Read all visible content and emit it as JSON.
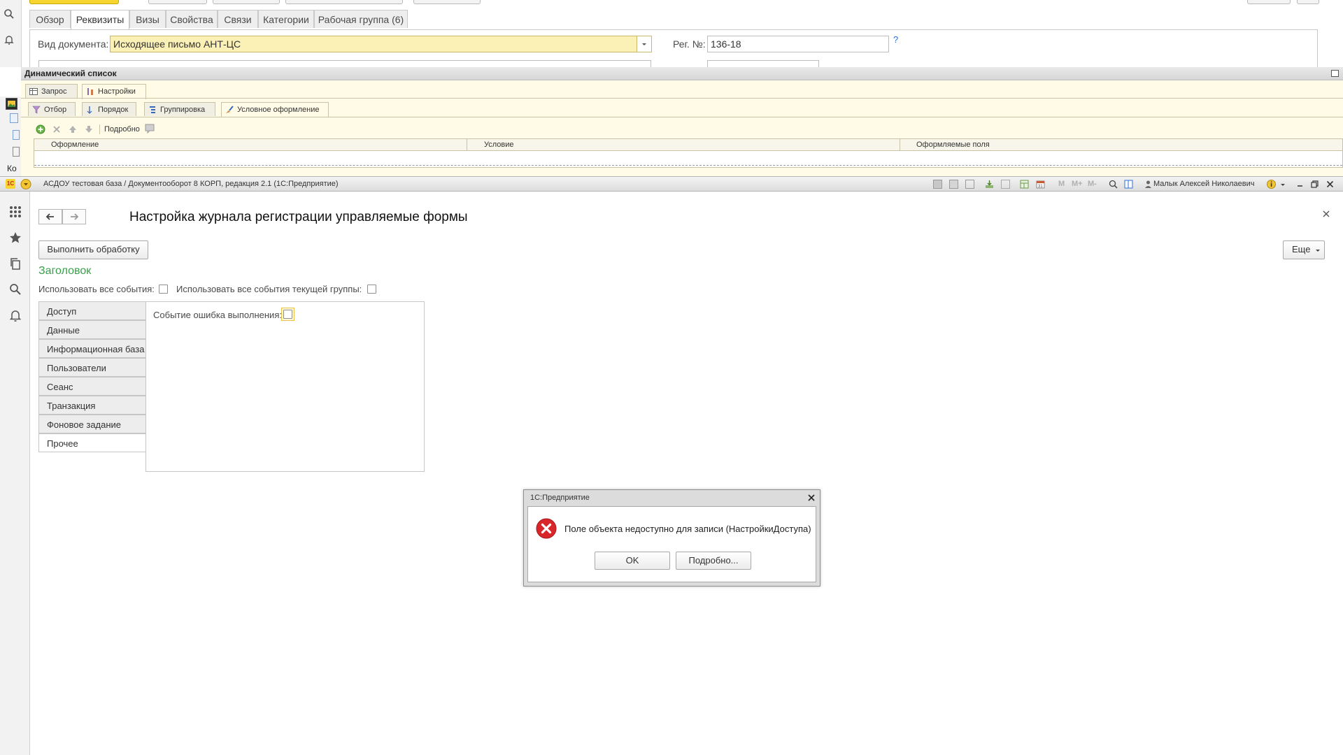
{
  "background_form": {
    "tabs": [
      "Обзор",
      "Реквизиты",
      "Визы",
      "Свойства",
      "Связи",
      "Категории",
      "Рабочая группа (6)"
    ],
    "active_tab": "Реквизиты",
    "doc_type_label": "Вид документа:",
    "doc_type_value": "Исходящее письмо АНТ-ЦС",
    "reg_no_label": "Рег. №:",
    "reg_no_value": "136-18",
    "help_mark": "?",
    "left_label_partial": "Ко"
  },
  "dynamic_list": {
    "title": "Динамический список",
    "tabs": [
      "Запрос",
      "Настройки"
    ],
    "subtabs": [
      "Отбор",
      "Порядок",
      "Группировка",
      "Условное оформление"
    ],
    "toolbar_more": "Подробно",
    "columns": [
      "Оформление",
      "Условие",
      "Оформляемые поля"
    ]
  },
  "titlebar": {
    "app_title": "АСДОУ тестовая база / Документооборот 8 КОРП, редакция 2.1  (1С:Предприятие)",
    "user_name": "Малык Алексей Николаевич",
    "memory_buttons": [
      "M",
      "M+",
      "M-"
    ]
  },
  "form": {
    "title": "Настройка журнала регистрации управляемые формы",
    "run_button": "Выполнить обработку",
    "more_button": "Еще",
    "group_title": "Заголовок",
    "use_all_events_label": "Использовать все события:",
    "use_all_group_events_label": "Использовать все события текущей группы:",
    "event_error_label": "Событие ошибка выполнения:",
    "vertical_tabs": [
      "Доступ",
      "Данные",
      "Информационная база",
      "Пользователи",
      "Сеанс",
      "Транзакция",
      "Фоновое задание",
      "Прочее"
    ],
    "active_vertical_tab": "Прочее"
  },
  "dialog": {
    "title": "1С:Предприятие",
    "message": "Поле объекта недоступно для записи (НастройкиДоступа)",
    "ok_button": "OK",
    "details_button": "Подробно..."
  },
  "colors": {
    "accent_green": "#3a9f4b",
    "error_red": "#d9262b",
    "yellow_field": "#fbf0b6",
    "brand_yellow": "#f7d531"
  }
}
